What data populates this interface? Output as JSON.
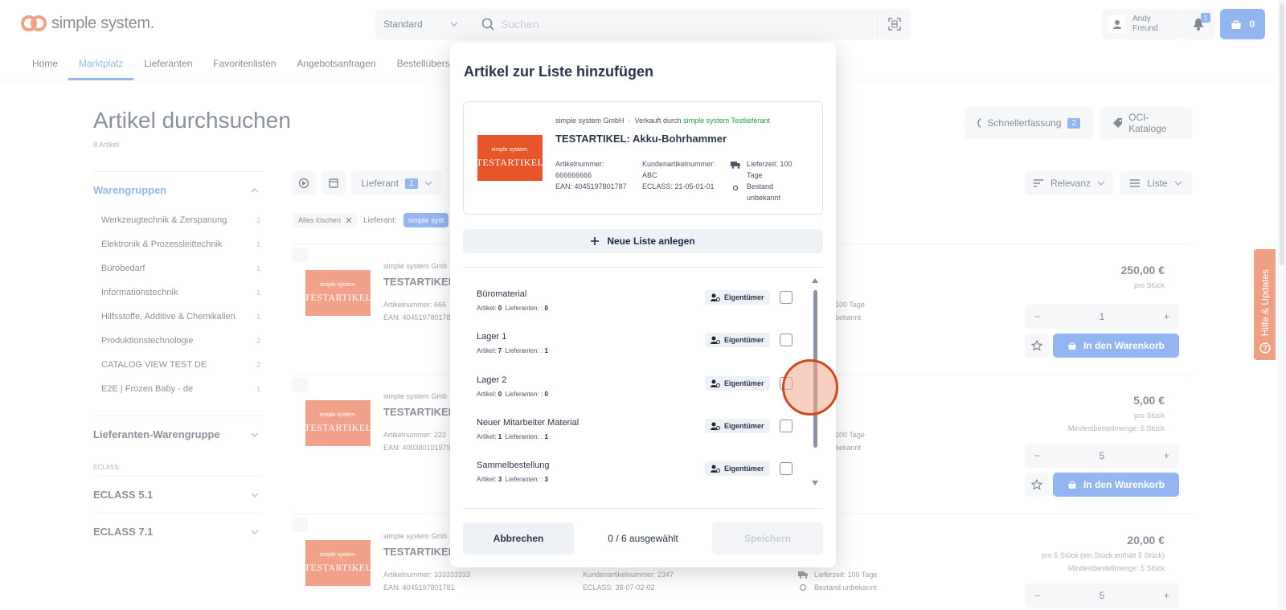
{
  "header": {
    "logo_text": "simple system.",
    "search_scope": "Standard",
    "search_placeholder": "Suchen",
    "user_first": "Andy",
    "user_last": "Freund",
    "notifications": "1",
    "cart_count": "0"
  },
  "nav": [
    "Home",
    "Marktplatz",
    "Lieferanten",
    "Favoritenlisten",
    "Angebotsanfragen",
    "Bestellübersicht"
  ],
  "page": {
    "title": "Artikel durchsuchen",
    "subtitle": "8 Artikel",
    "quick_entry": "Schnellerfassung",
    "quick_entry_count": "2",
    "oci": "OCI-Kataloge"
  },
  "sidebar": {
    "section1": "Warengruppen",
    "items": [
      {
        "label": "Werkzeugtechnik & Zerspanung",
        "count": "2"
      },
      {
        "label": "Elektronik & Prozessleittechnik",
        "count": "1"
      },
      {
        "label": "Bürobedarf",
        "count": "1"
      },
      {
        "label": "Informationstechnik",
        "count": "1"
      },
      {
        "label": "Hilfsstoffe, Additive & Chemikalien",
        "count": "1"
      },
      {
        "label": "Produktionstechnologie",
        "count": "2"
      },
      {
        "label": "CATALOG VIEW TEST DE",
        "count": "2"
      },
      {
        "label": "E2E | Frozen Baby - de",
        "count": "1"
      }
    ],
    "section2": "Lieferanten-Warengruppe",
    "eclass_label": "ECLASS:",
    "section3": "ECLASS 5.1",
    "section4": "ECLASS 7.1"
  },
  "toolbar": {
    "supplier": "Lieferant",
    "supplier_count": "1",
    "sort": "Relevanz",
    "view": "Liste"
  },
  "filters": {
    "clear_all": "Alles löschen",
    "supplier_label": "Lieferant:",
    "supplier_chip": "simple syst"
  },
  "products": [
    {
      "vendor": "simple system Gmb",
      "title": "TESTARTIKEL: ",
      "artnr": "Artikelnummer: 666",
      "ean": "EAN: 404519780178",
      "delivery": "100 Tage",
      "stock": "bekannt",
      "price": "250,00 €",
      "unit": "pro Stück",
      "min": "",
      "qty": "1"
    },
    {
      "vendor": "simple system Gmb",
      "title": "TESTARTIKEL: ",
      "artnr": "Artikelnummer: 222",
      "ean": "EAN: 400380101979",
      "delivery": "100 Tage",
      "stock": "bekannt",
      "price": "5,00 €",
      "unit": "pro Stück",
      "min": "Mindestbestellmenge: 5 Stück",
      "qty": "5"
    },
    {
      "vendor": "simple system Gmb",
      "title": "TESTARTIKEL: ",
      "artnr": "Artikelnummer: 333333333",
      "ean": "EAN: 4045197801781",
      "custnr": "Kundenartikelnummer: 2347",
      "eclass": "ECLASS: 38-07-02-02",
      "delivery": "Lieferzeit: 100 Tage",
      "stock": "Bestand unbekannt",
      "price": "20,00 €",
      "unit": "pro 5 Stück (ein Stück enthält 5 Stück)",
      "min": "Mindestbestellmenge: 5 Stück",
      "qty": "5"
    }
  ],
  "add_to_cart": "In den Warenkorb",
  "image_brand": "simple system.",
  "image_text": "TESTARTIKEL",
  "help_tab": "Hilfe & Updates",
  "modal": {
    "title": "Artikel zur Liste hinzufügen",
    "vendor": "simple system GmbH",
    "sold_by_prefix": "Verkauft durch",
    "sold_by": "simple system Testlieferant",
    "product_title": "TESTARTIKEL: Akku-Bohrhammer",
    "artnr_label": "Artikelnummer:",
    "artnr": "666666666",
    "ean": "EAN: 4045197801787",
    "custnr_label": "Kundenartikelnummer:",
    "custnr": "ABC",
    "eclass": "ECLASS: 21-05-01-01",
    "delivery_1": "Lieferzeit: 100",
    "delivery_2": "Tage",
    "stock_1": "Bestand",
    "stock_2": "unbekannt",
    "new_list": "Neue Liste anlegen",
    "lists": [
      {
        "name": "Büromaterial",
        "articles": "0",
        "suppliers": "0"
      },
      {
        "name": "Lager 1",
        "articles": "7",
        "suppliers": "1"
      },
      {
        "name": "Lager 2",
        "articles": "0",
        "suppliers": "0"
      },
      {
        "name": "Neuer Mitarbeiter Material",
        "articles": "1",
        "suppliers": "1"
      },
      {
        "name": "Sammelbestellung",
        "articles": "3",
        "suppliers": "3"
      }
    ],
    "articles_label": "Artikel:",
    "suppliers_label": "Lieferanten: :",
    "owner": "Eigentümer",
    "cancel": "Abbrechen",
    "selected": "0 / 6 ausgewählt",
    "save": "Speichern"
  }
}
